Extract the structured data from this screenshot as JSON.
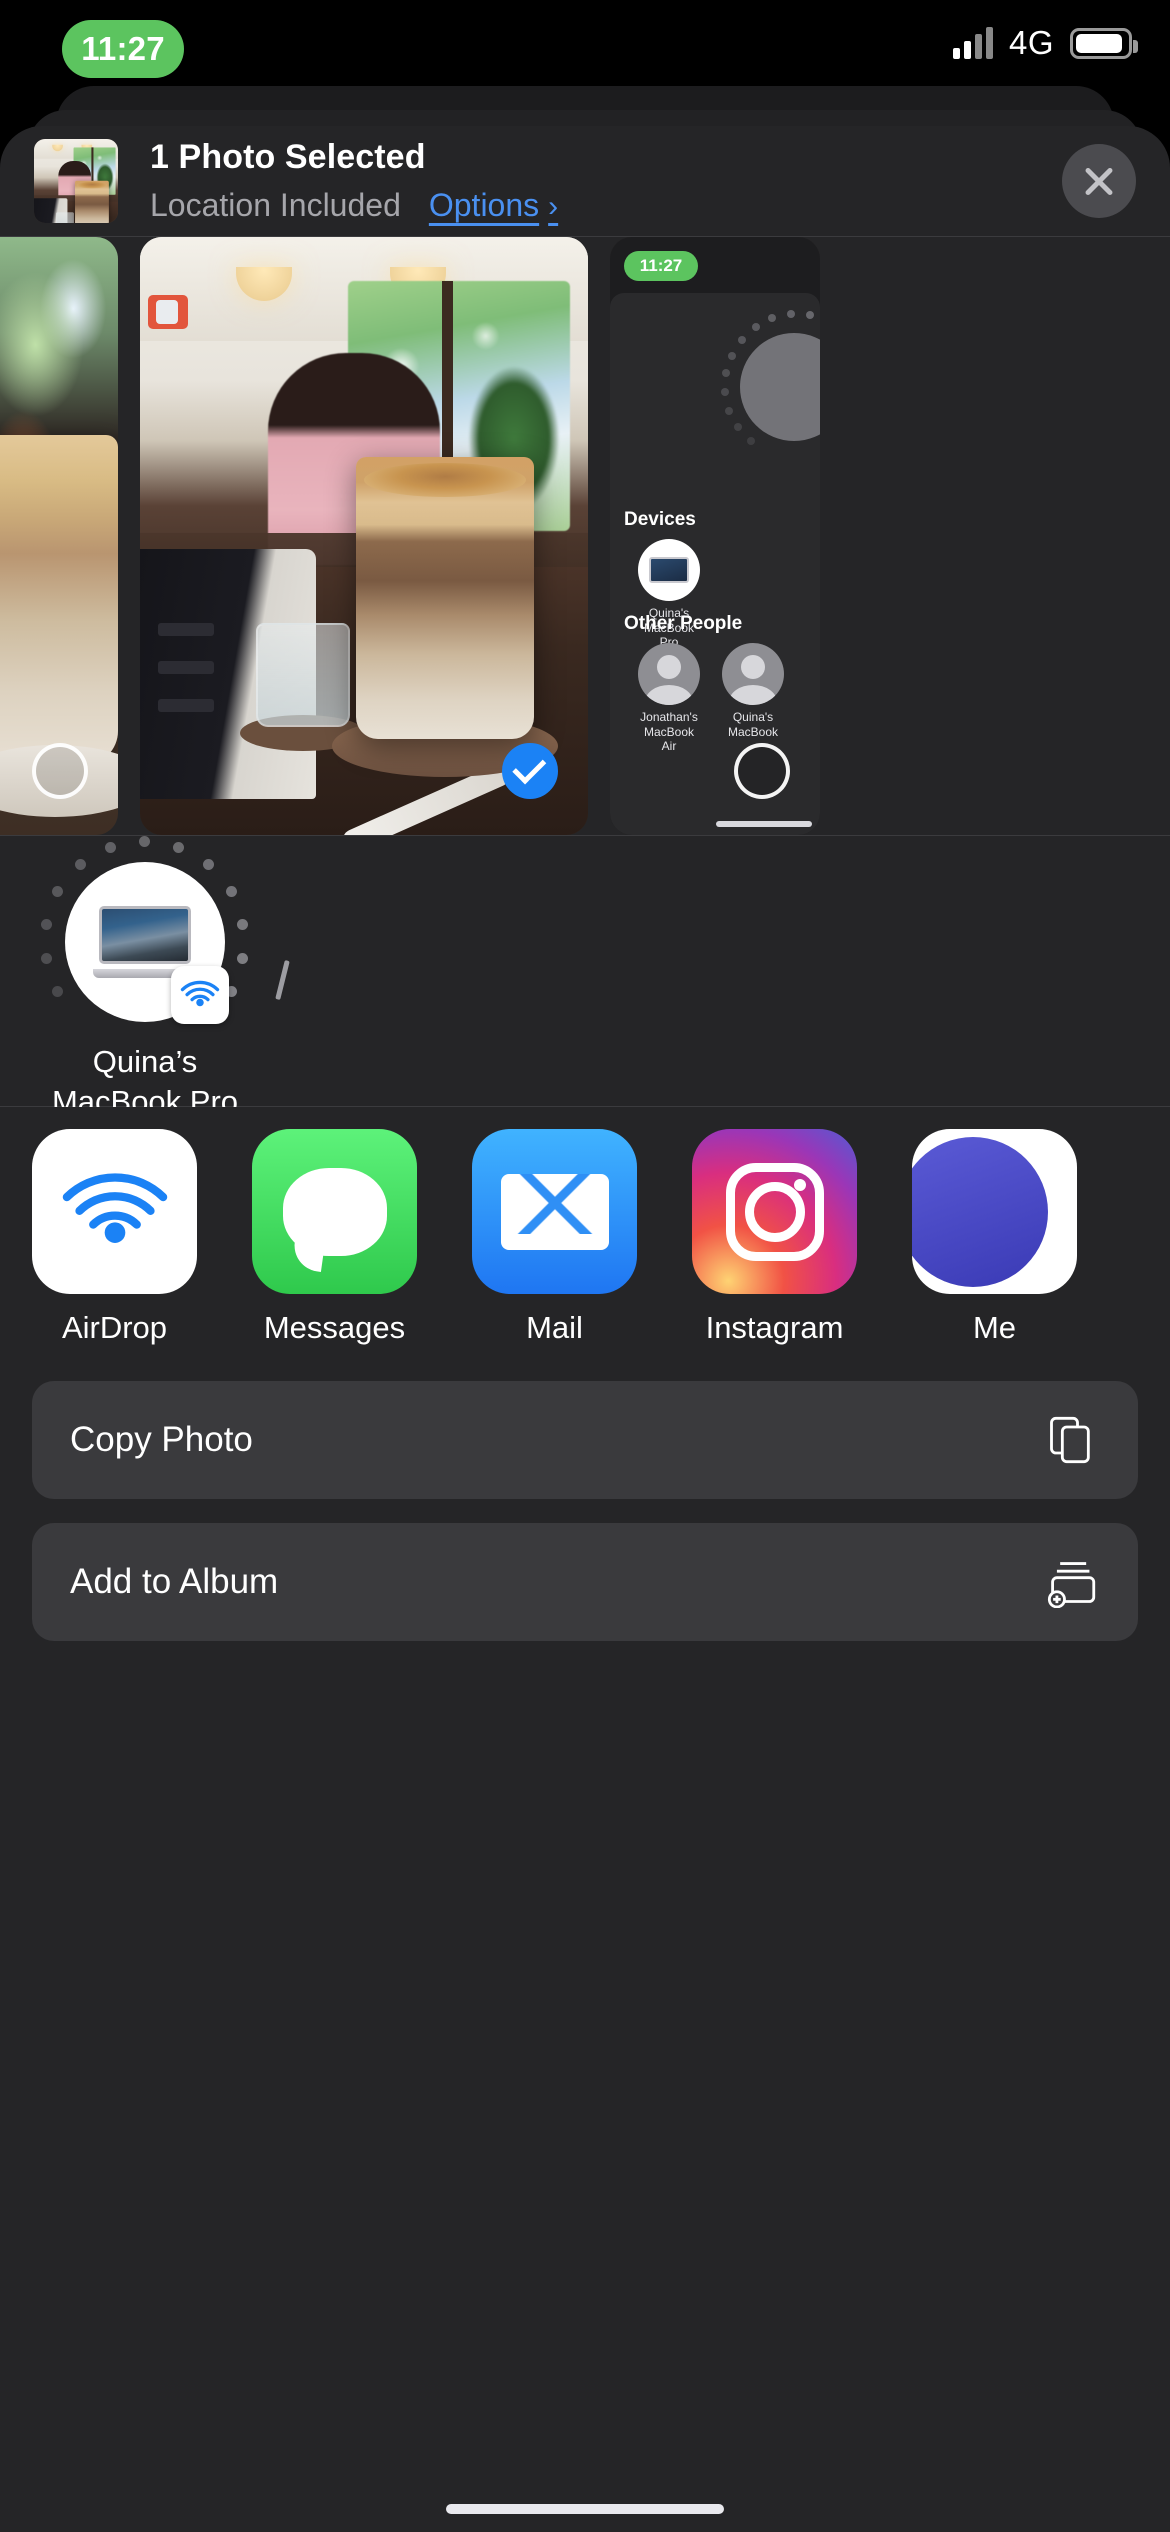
{
  "status_bar": {
    "time": "11:27",
    "network": "4G",
    "recording_indicator": true
  },
  "header": {
    "title": "1 Photo Selected",
    "subtitle_location": "Location Included",
    "options_label": "Options",
    "options_chevron": "›",
    "close_label": "Close"
  },
  "carousel": {
    "photos": [
      {
        "name": "photo-partial-left",
        "selected": false,
        "alt": "Iced latte glass on wooden table"
      },
      {
        "name": "photo-cafe-latte",
        "selected": true,
        "alt": "Iced latte in cafe with laptop and water glass"
      },
      {
        "name": "photo-airdrop-screenshot",
        "selected": false,
        "alt": "Screenshot of AirDrop sharing panel"
      }
    ]
  },
  "screenshot_preview": {
    "time": "11:27",
    "devices_heading": "Devices",
    "device_name": "Quina's\nMacBook Pro",
    "device_name_line1": "Quina's",
    "device_name_line2": "MacBook Pro",
    "other_people_heading": "Other People",
    "people": [
      {
        "line1": "Jonathan's",
        "line2": "MacBook Air"
      },
      {
        "line1": "Quina's",
        "line2": "MacBook"
      }
    ]
  },
  "airdrop": {
    "device_name_line1": "Quina’s",
    "device_name_line2": "MacBook Pro",
    "badge_icon": "airdrop-icon"
  },
  "apps": [
    {
      "label": "AirDrop",
      "icon": "airdrop-icon"
    },
    {
      "label": "Messages",
      "icon": "messages-icon"
    },
    {
      "label": "Mail",
      "icon": "mail-icon"
    },
    {
      "label": "Instagram",
      "icon": "instagram-icon"
    },
    {
      "label": "Me",
      "icon": "more-icon"
    }
  ],
  "actions": [
    {
      "label": "Copy Photo",
      "icon": "copy-icon"
    },
    {
      "label": "Add to Album",
      "icon": "add-to-album-icon"
    }
  ],
  "colors": {
    "accent_blue": "#4a90f0",
    "selected_blue": "#1b82f5",
    "recording_green": "#5cc45f",
    "sheet_bg": "#252527",
    "card_bg": "#3a3a3d"
  }
}
